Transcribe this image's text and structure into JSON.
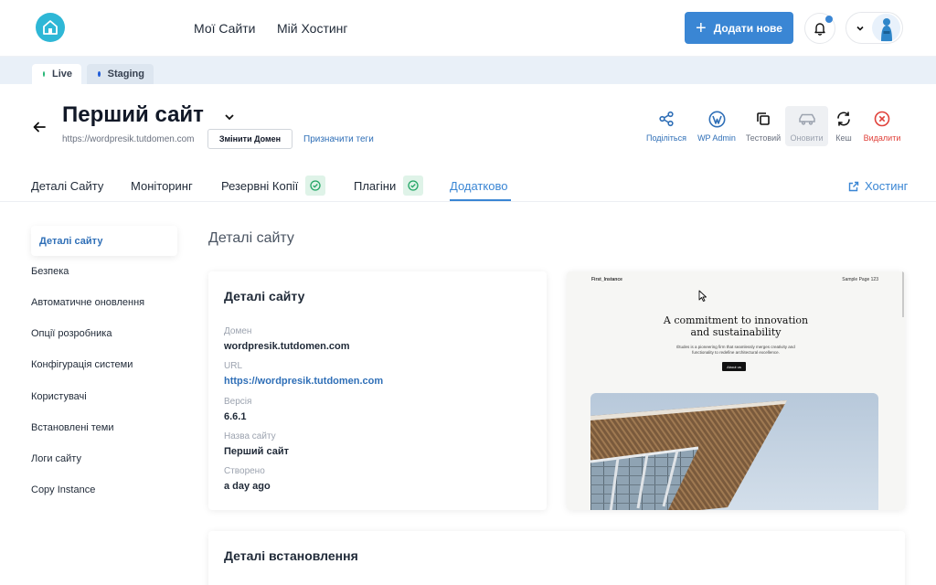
{
  "nav": {
    "my_sites": "Мої Сайти",
    "my_hosting": "Мій Хостинг",
    "add_new": "Додати нове"
  },
  "env": {
    "live": "Live",
    "staging": "Staging"
  },
  "site": {
    "title": "Перший сайт",
    "url": "https://wordpresik.tutdomen.com",
    "change_domain": "Змінити Домен",
    "assign_tags": "Призначити теги"
  },
  "actions": {
    "share": "Поділіться",
    "wp_admin": "WP Admin",
    "test": "Тестовий",
    "update": "Оновити",
    "cache": "Кеш",
    "delete": "Видалити"
  },
  "tabs": {
    "details": "Деталі Сайту",
    "monitoring": "Моніторинг",
    "backups": "Резервні Копії",
    "plugins": "Плагіни",
    "extra": "Додатково",
    "hosting": "Хостинг"
  },
  "sidebar": {
    "items": [
      "Деталі сайту",
      "Безпека",
      "Автоматичне оновлення",
      "Опції розробника",
      "Конфігурація системи",
      "Користувачі",
      "Встановлені теми",
      "Логи сайту",
      "Copy Instance"
    ]
  },
  "main": {
    "section_title": "Деталі сайту",
    "card_title": "Деталі сайту",
    "fields": {
      "domain_label": "Домен",
      "domain_value": "wordpresik.tutdomen.com",
      "url_label": "URL",
      "url_value": "https://wordpresik.tutdomen.com",
      "version_label": "Версія",
      "version_value": "6.6.1",
      "name_label": "Назва сайту",
      "name_value": "Перший сайт",
      "created_label": "Створено",
      "created_value": "a day ago"
    },
    "install_title": "Деталі встановлення"
  },
  "preview": {
    "brand": "First_Instance",
    "menu": "Sample Page 123",
    "heading_line1": "A commitment to innovation",
    "heading_line2": "and sustainability",
    "sub_line1": "Études is a pioneering firm that seamlessly merges creativity and",
    "sub_line2": "functionality to redefine architectural excellence.",
    "button": "About us"
  },
  "colors": {
    "accent": "#3a86d4",
    "live_dot": "#22b573",
    "staging_dot": "#1e5bd8",
    "danger": "#e0413a",
    "success_bg": "#dff3e8"
  },
  "icons": {
    "share": "share-icon",
    "wp": "wordpress-icon",
    "copy": "copy-icon",
    "update": "car-icon",
    "cache": "refresh-icon",
    "delete": "delete-circle-icon"
  }
}
